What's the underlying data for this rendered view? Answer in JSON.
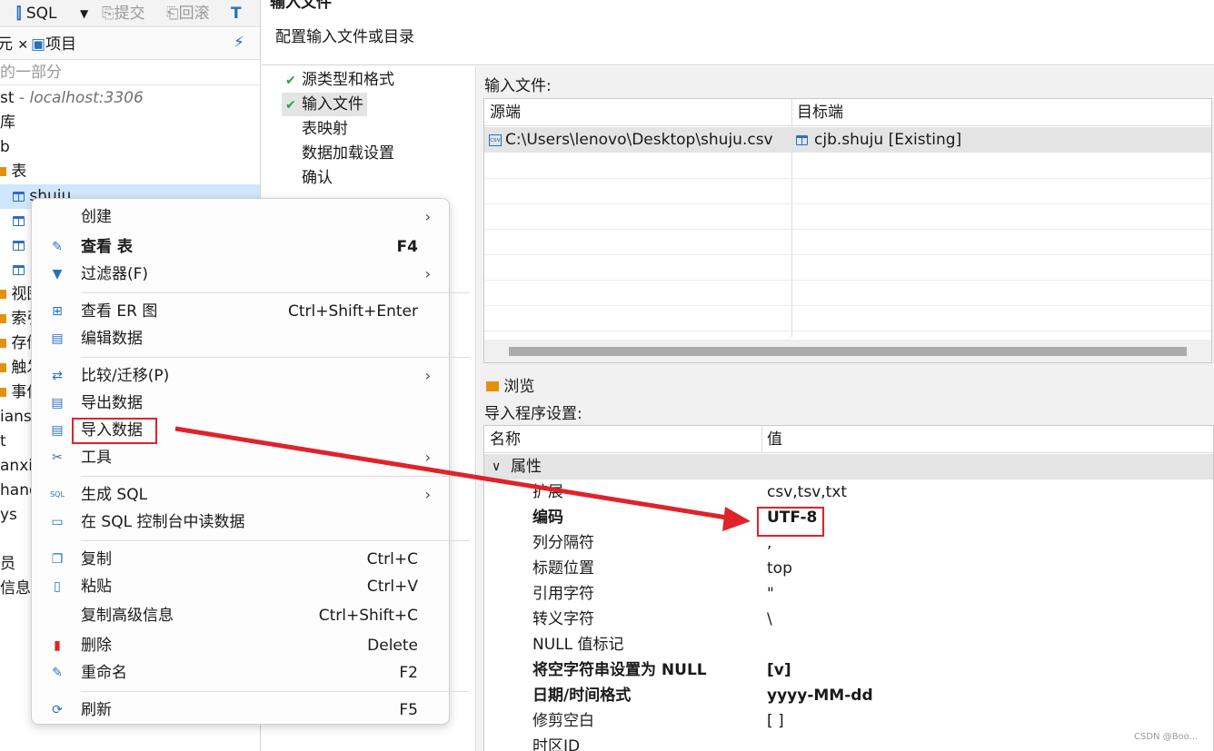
{
  "toolbar": {
    "sql": "SQL",
    "commit": "提交",
    "rollback": "回滚"
  },
  "navigator": {
    "tab_partial": "元",
    "tab_project": "项目",
    "filter_placeholder": "的一部分",
    "tree": [
      {
        "text": "st",
        "suffix": " - localhost:3306"
      },
      {
        "text": "库"
      },
      {
        "text": "b"
      },
      {
        "text": "表"
      },
      {
        "text": "shuju"
      },
      {
        "text": ""
      },
      {
        "text": ""
      },
      {
        "text": ""
      },
      {
        "text": "视图"
      },
      {
        "text": "索引"
      },
      {
        "text": "存储"
      },
      {
        "text": "触发"
      },
      {
        "text": "事件"
      },
      {
        "text": "ians"
      },
      {
        "text": "t"
      },
      {
        "text": "anxi"
      },
      {
        "text": "hang"
      },
      {
        "text": "ys"
      },
      {
        "text": ""
      },
      {
        "text": "员"
      },
      {
        "text": "信息"
      }
    ]
  },
  "wizard": {
    "title": "输入文件",
    "subtitle": "配置输入文件或目录",
    "steps": [
      {
        "label": "源类型和格式",
        "done": true
      },
      {
        "label": "输入文件",
        "done": true,
        "active": true
      },
      {
        "label": "表映射",
        "done": false
      },
      {
        "label": "数据加载设置",
        "done": false
      },
      {
        "label": "确认",
        "done": false
      }
    ],
    "input_files_label": "输入文件:",
    "columns": {
      "source": "源端",
      "target": "目标端"
    },
    "file_row": {
      "source": "C:\\Users\\lenovo\\Desktop\\shuju.csv",
      "target": "cjb.shuju [Existing]"
    },
    "browse_label": "浏览",
    "importer_settings_label": "导入程序设置:",
    "props_columns": {
      "name": "名称",
      "value": "值"
    },
    "group_label": "属性",
    "properties": [
      {
        "name": "扩展",
        "value": "csv,tsv,txt",
        "bold": false
      },
      {
        "name": "编码",
        "value": "UTF-8",
        "bold": true
      },
      {
        "name": "列分隔符",
        "value": ",",
        "bold": false
      },
      {
        "name": "标题位置",
        "value": "top",
        "bold": false
      },
      {
        "name": "引用字符",
        "value": "\"",
        "bold": false
      },
      {
        "name": "转义字符",
        "value": "\\",
        "bold": false
      },
      {
        "name": "NULL 值标记",
        "value": "",
        "bold": false
      },
      {
        "name": "将空字符串设置为 NULL",
        "value": "[v]",
        "bold": true
      },
      {
        "name": "日期/时间格式",
        "value": "yyyy-MM-dd",
        "bold": true
      },
      {
        "name": "修剪空白",
        "value": "[ ]",
        "bold": false
      },
      {
        "name": "时区ID",
        "value": "",
        "bold": false
      }
    ]
  },
  "context_menu": {
    "items": [
      {
        "label": "创建",
        "shortcut": "",
        "submenu": true,
        "icon": "none"
      },
      {
        "label": "查看 表",
        "shortcut": "F4",
        "submenu": false,
        "bold": true,
        "icon": "pencil-icon"
      },
      {
        "label": "过滤器(F)",
        "shortcut": "",
        "submenu": true,
        "icon": "filter-icon"
      },
      {
        "label": "查看 ER 图",
        "shortcut": "Ctrl+Shift+Enter",
        "submenu": false,
        "icon": "er-diagram-icon"
      },
      {
        "label": "编辑数据",
        "shortcut": "",
        "submenu": false,
        "icon": "edit-data-icon"
      },
      {
        "label": "比较/迁移(P)",
        "shortcut": "",
        "submenu": true,
        "icon": "compare-icon"
      },
      {
        "label": "导出数据",
        "shortcut": "",
        "submenu": false,
        "icon": "export-icon"
      },
      {
        "label": "导入数据",
        "shortcut": "",
        "submenu": false,
        "icon": "import-icon"
      },
      {
        "label": "工具",
        "shortcut": "",
        "submenu": true,
        "icon": "tools-icon"
      },
      {
        "label": "生成 SQL",
        "shortcut": "",
        "submenu": true,
        "icon": "sql-icon"
      },
      {
        "label": "在 SQL 控制台中读数据",
        "shortcut": "",
        "submenu": false,
        "icon": "console-icon"
      },
      {
        "label": "复制",
        "shortcut": "Ctrl+C",
        "submenu": false,
        "icon": "copy-icon"
      },
      {
        "label": "粘贴",
        "shortcut": "Ctrl+V",
        "submenu": false,
        "icon": "paste-icon"
      },
      {
        "label": "复制高级信息",
        "shortcut": "Ctrl+Shift+C",
        "submenu": false,
        "icon": "none"
      },
      {
        "label": "删除",
        "shortcut": "Delete",
        "submenu": false,
        "icon": "delete-icon"
      },
      {
        "label": "重命名",
        "shortcut": "F2",
        "submenu": false,
        "icon": "rename-icon"
      },
      {
        "label": "刷新",
        "shortcut": "F5",
        "submenu": false,
        "icon": "refresh-icon"
      }
    ]
  },
  "watermark": "CSDN @Boo...",
  "colors": {
    "annotation": "#e0222a",
    "selection": "#cfe6fb",
    "check": "#27a348"
  }
}
